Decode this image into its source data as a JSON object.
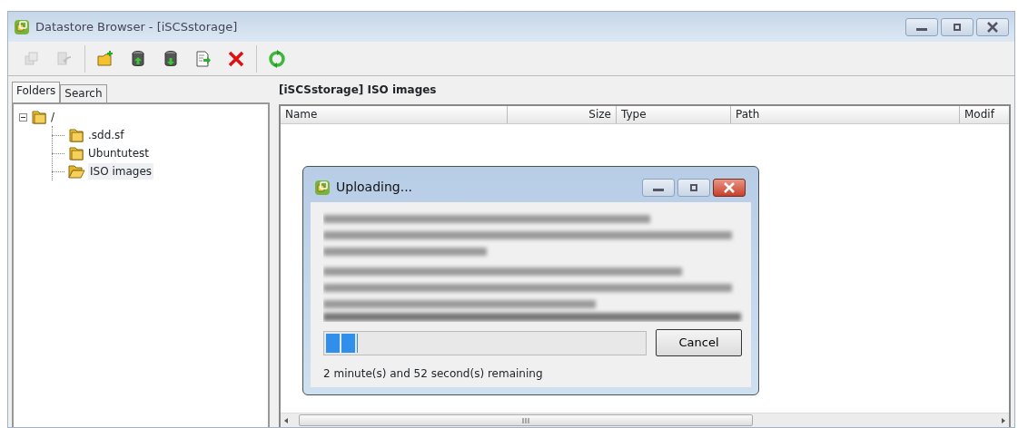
{
  "window": {
    "title": "Datastore Browser - [iSCSstorage]"
  },
  "toolbar": [
    {
      "kind": "copy",
      "disabled": true
    },
    {
      "kind": "move",
      "disabled": true
    },
    {
      "kind": "new-folder",
      "disabled": false
    },
    {
      "kind": "upload",
      "disabled": false
    },
    {
      "kind": "download",
      "disabled": false
    },
    {
      "kind": "register",
      "disabled": false
    },
    {
      "kind": "delete",
      "disabled": false
    },
    {
      "kind": "refresh",
      "disabled": false
    }
  ],
  "tabs": [
    {
      "label": "Folders",
      "selected": true
    },
    {
      "label": "Search",
      "selected": false
    }
  ],
  "tree": [
    {
      "label": "/",
      "expanded": true,
      "selected": false,
      "children": [
        {
          "label": ".sdd.sf",
          "selected": false
        },
        {
          "label": "Ubuntutest",
          "selected": false
        },
        {
          "label": "ISO images",
          "selected": true
        }
      ]
    }
  ],
  "content": {
    "title": "[iSCSstorage] ISO images",
    "columns": [
      {
        "label": "Name",
        "kind": "text"
      },
      {
        "label": "Size",
        "kind": "number"
      },
      {
        "label": "Type",
        "kind": "text"
      },
      {
        "label": "Path",
        "kind": "text"
      },
      {
        "label": "Modif",
        "kind": "text"
      }
    ]
  },
  "dialog": {
    "title": "Uploading...",
    "progress": {
      "level": 0.1
    },
    "cancel": "Cancel",
    "remaining": "2 minute(s) and 52 second(s) remaining"
  }
}
